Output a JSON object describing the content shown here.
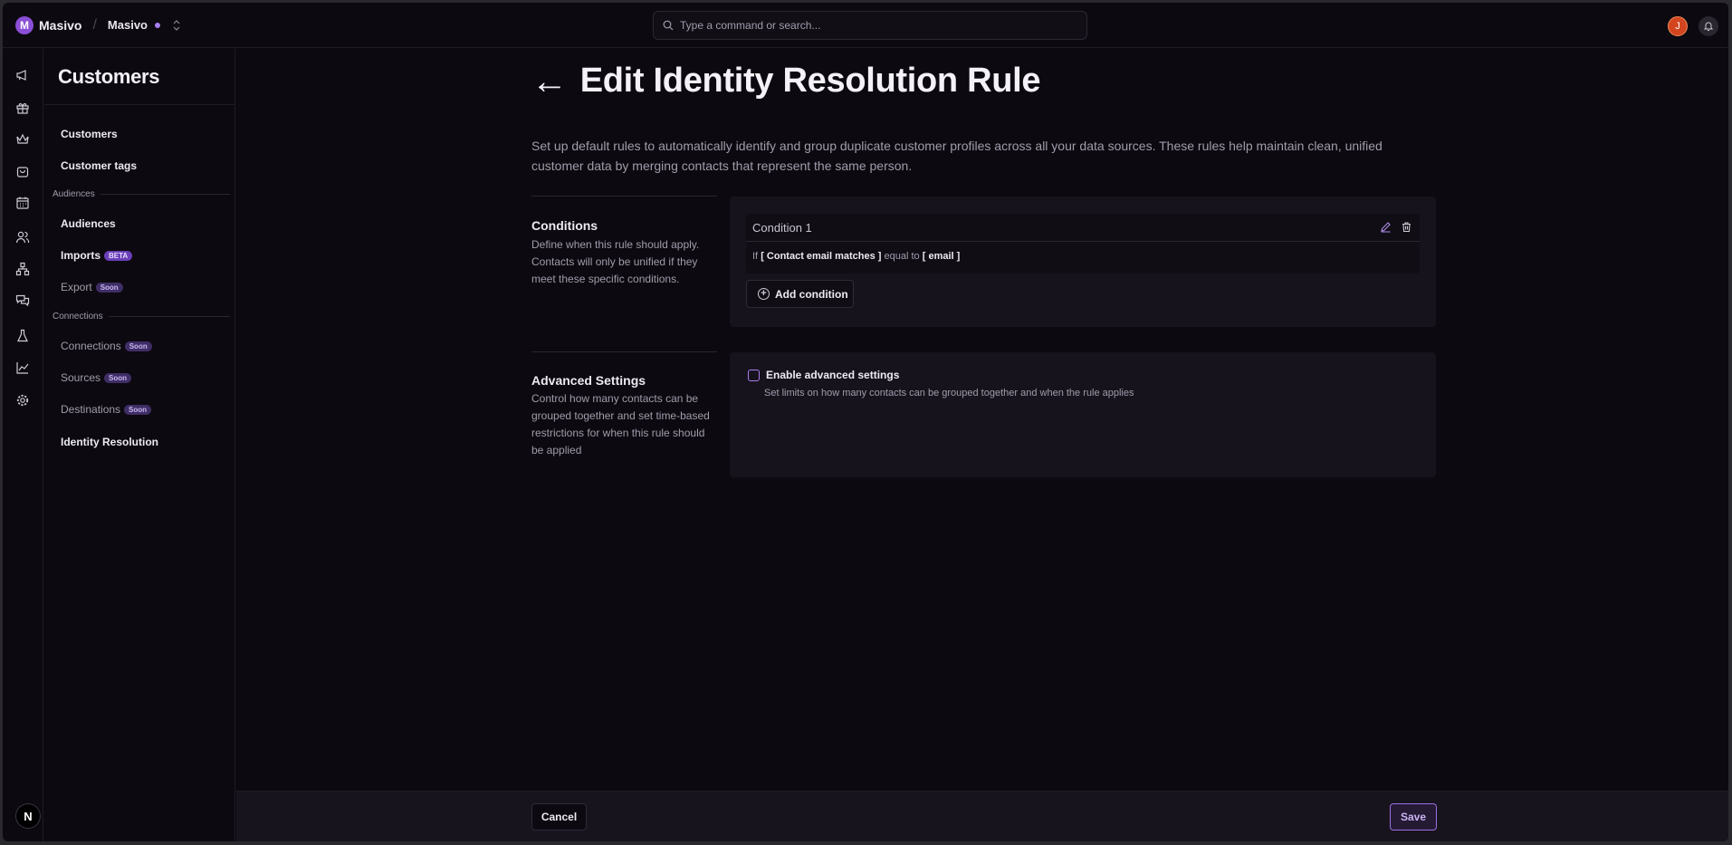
{
  "app": {
    "brand": "Masivo",
    "brand_initial": "M",
    "org": "Masivo",
    "avatar_initial": "J"
  },
  "search": {
    "placeholder": "Type a command or search..."
  },
  "rail": {
    "icons": [
      "megaphone-icon",
      "gift-icon",
      "crown-icon",
      "bag-icon",
      "calendar-icon",
      "users-icon",
      "network-icon",
      "chat-icon",
      "flask-icon",
      "chart-icon",
      "gear-icon"
    ],
    "bottom_badge": "N"
  },
  "sidenav": {
    "title": "Customers",
    "items_top": [
      {
        "label": "Customers"
      },
      {
        "label": "Customer tags"
      }
    ],
    "audiences_label": "Audiences",
    "audiences": [
      {
        "label": "Audiences",
        "badge": ""
      },
      {
        "label": "Imports",
        "badge": "BETA"
      },
      {
        "label": "Export",
        "badge": "Soon"
      }
    ],
    "connections_label": "Connections",
    "connections": [
      {
        "label": "Connections",
        "badge": "Soon"
      },
      {
        "label": "Sources",
        "badge": "Soon"
      },
      {
        "label": "Destinations",
        "badge": "Soon"
      },
      {
        "label": "Identity Resolution",
        "badge": ""
      }
    ]
  },
  "main": {
    "back_arrow": "←",
    "title": "Edit Identity Resolution Rule",
    "description": "Set up default rules to automatically identify and group duplicate customer profiles across all your data sources. These rules help maintain clean, unified customer data by merging contacts that represent the same person.",
    "conditions": {
      "title": "Conditions",
      "description": "Define when this rule should apply. Contacts will only be unified if they meet these specific conditions.",
      "card_title": "Condition 1",
      "rule_if": "If",
      "rule_field": "[ Contact email matches ]",
      "rule_op": "equal to",
      "rule_value": "[ email ]",
      "add_label": "Add condition"
    },
    "advanced": {
      "title": "Advanced Settings",
      "description": "Control how many contacts can be grouped together and set time-based restrictions for when this rule should be applied",
      "checkbox_label": "Enable advanced settings",
      "checkbox_checked": false,
      "checkbox_help": "Set limits on how many contacts can be grouped together and when the rule applies"
    }
  },
  "footer": {
    "cancel": "Cancel",
    "save": "Save"
  },
  "colors": {
    "accent": "#a77ef0",
    "background": "#0c0910",
    "panel": "#17131d",
    "avatar": "#d2451e"
  }
}
